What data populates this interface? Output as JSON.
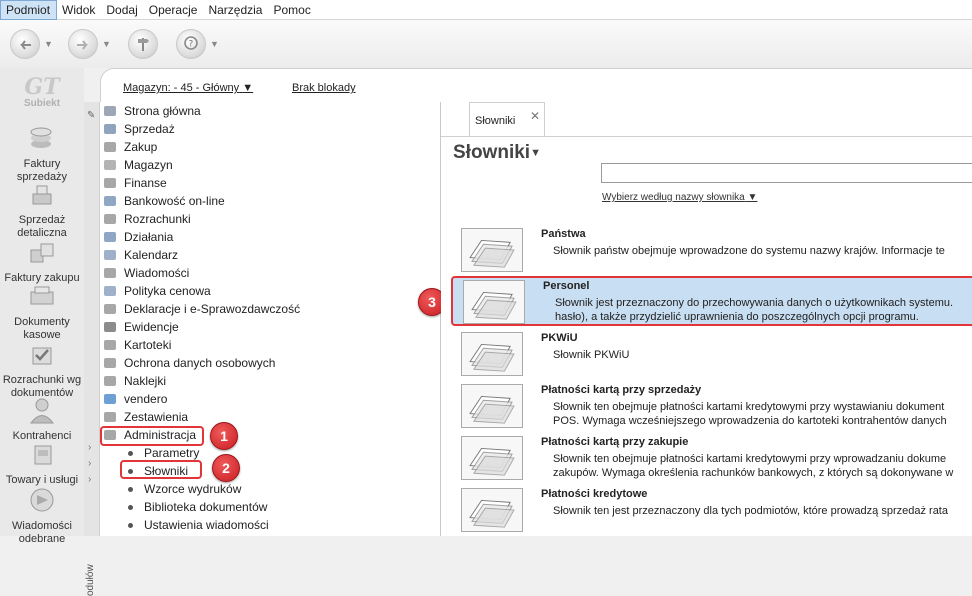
{
  "menu": [
    "Podmiot",
    "Widok",
    "Dodaj",
    "Operacje",
    "Narzędzia",
    "Pomoc"
  ],
  "toolbar": {
    "icons": [
      "back-arrow-icon",
      "forward-arrow-icon",
      "signpost-icon",
      "help-icon"
    ]
  },
  "logo": {
    "mark": "GT",
    "name": "Subiekt"
  },
  "leftbar": [
    {
      "label": "Faktury sprzedaży",
      "icon": "coins-icon"
    },
    {
      "label": "Sprzedaż detaliczna",
      "icon": "scale-icon"
    },
    {
      "label": "Faktury zakupu",
      "icon": "boxes-icon"
    },
    {
      "label": "Dokumenty kasowe",
      "icon": "cash-icon"
    },
    {
      "label": "Rozrachunki wg dokumentów",
      "icon": "checkmark-docs-icon"
    },
    {
      "label": "Kontrahenci",
      "icon": "person-icon"
    },
    {
      "label": "Towary i usługi",
      "icon": "goods-icon"
    },
    {
      "label": "Wiadomości odebrane",
      "icon": "mail-icon"
    }
  ],
  "panel_header": {
    "warehouse": "Magazyn: - 45 - Główny",
    "lock": "Brak blokady"
  },
  "strip": {
    "vertical_text": "odułów"
  },
  "nav": [
    "Strona główna",
    "Sprzedaż",
    "Zakup",
    "Magazyn",
    "Finanse",
    "Bankowość on-line",
    "Rozrachunki",
    "Działania",
    "Kalendarz",
    "Wiadomości",
    "Polityka cenowa",
    "Deklaracje i e-Sprawozdawczość",
    "Ewidencje",
    "Kartoteki",
    "Ochrona danych osobowych",
    "Naklejki",
    "vendero",
    "Zestawienia",
    "Administracja"
  ],
  "nav_sub": [
    "Parametry",
    "Słowniki",
    "Wzorce wydruków",
    "Biblioteka dokumentów",
    "Ustawienia wiadomości"
  ],
  "badges": [
    "1",
    "2",
    "3"
  ],
  "content": {
    "tab_label": "Słowniki",
    "tab_close": "✕",
    "title": "Słowniki",
    "search_placeholder": "",
    "search_link": "Wybierz według nazwy słownika"
  },
  "dictionaries": [
    {
      "title": "Państwa",
      "desc": [
        "Słownik państw obejmuje wprowadzone do systemu nazwy krajów. Informacje te"
      ]
    },
    {
      "title": "Personel",
      "desc": [
        "Słownik jest przeznaczony do przechowywania danych o użytkownikach systemu.",
        "hasło), a także przydzielić uprawnienia do poszczególnych opcji programu."
      ]
    },
    {
      "title": "PKWiU",
      "desc": [
        "Słownik PKWiU"
      ]
    },
    {
      "title": "Płatności kartą przy sprzedaży",
      "desc": [
        "Słownik ten obejmuje płatności kartami kredytowymi przy wystawianiu dokument",
        "POS. Wymaga wcześniejszego wprowadzenia do kartoteki kontrahentów danych"
      ]
    },
    {
      "title": "Płatności kartą przy zakupie",
      "desc": [
        "Słownik ten obejmuje płatności kartami kredytowymi przy wprowadzaniu dokume",
        "zakupów. Wymaga określenia rachunków bankowych, z których są dokonywane w"
      ]
    },
    {
      "title": "Płatności kredytowe",
      "desc": [
        "Słownik ten jest przeznaczony dla tych podmiotów, które prowadzą sprzedaż rata"
      ]
    }
  ],
  "colors": {
    "highlight_red": "#e3343a",
    "selected_row": "#c8def2",
    "menu_active": "#cfe3f6"
  }
}
